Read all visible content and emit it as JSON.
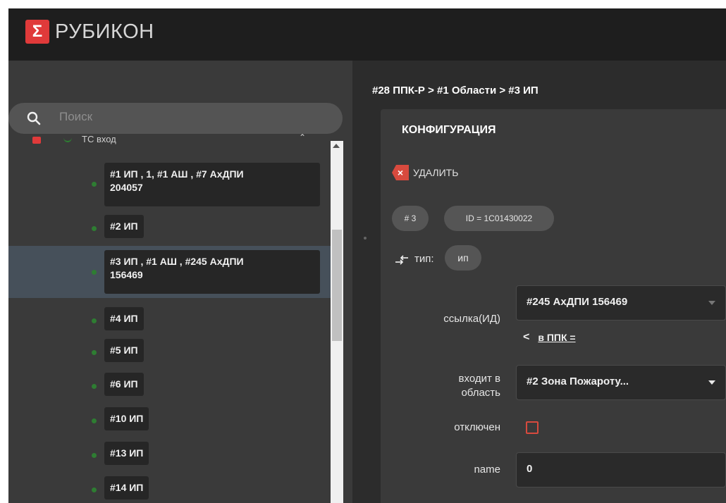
{
  "app": {
    "logo_glyph": "Σ",
    "title": "РУБИКОН",
    "brand_color": "#e03a3a"
  },
  "search": {
    "placeholder": "Поиск",
    "icon": "search-icon"
  },
  "tree": {
    "partial_item_text": "ТС вход",
    "items": [
      {
        "label": "#1 ИП , 1, #1 АШ , #7 АхДПИ 204057",
        "line1": "#1 ИП , 1, #1 АШ , #7 АхДПИ",
        "line2": "204057",
        "selected": false
      },
      {
        "label": "#2 ИП",
        "selected": false
      },
      {
        "label": "#3 ИП , #1 АШ , #245 АхДПИ 156469",
        "line1": "#3 ИП , #1 АШ , #245 АхДПИ",
        "line2": "156469",
        "selected": true
      },
      {
        "label": "#4 ИП",
        "selected": false
      },
      {
        "label": "#5 ИП",
        "selected": false
      },
      {
        "label": "#6 ИП",
        "selected": false
      },
      {
        "label": "#10 ИП",
        "selected": false
      },
      {
        "label": "#13 ИП",
        "selected": false
      },
      {
        "label": "#14 ИП",
        "selected": false
      }
    ]
  },
  "breadcrumb": "#28 ППК-Р > #1 Области > #3 ИП",
  "config": {
    "title": "КОНФИГУРАЦИЯ",
    "delete_label": "УДАЛИТЬ",
    "chips": [
      "# 3",
      "ID = 1C01430022"
    ],
    "type_label": "тип:",
    "type_value": "ип",
    "fields": {
      "link_label": "ссылка(ИД)",
      "link_value": "#245 АхДПИ 156469",
      "back_link": "в ППК =",
      "area_label_line1": "входит в",
      "area_label_line2": "область",
      "area_value": "#2 Зона Пожароту...",
      "disabled_label": "отключен",
      "disabled_checked": false,
      "name_label": "name",
      "name_value": "0"
    }
  },
  "colors": {
    "header_bg": "#1e1e1e",
    "panel_bg": "#3a3a3a",
    "selected_row": "#46505a",
    "status_green": "#2e7d32",
    "accent_red": "#d84a3e"
  }
}
